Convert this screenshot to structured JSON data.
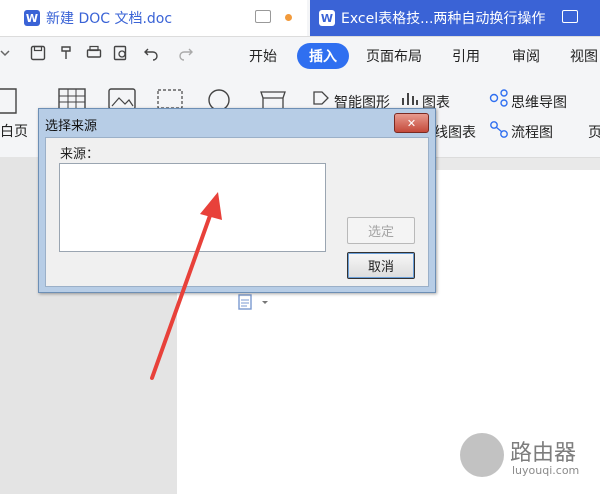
{
  "tabs": [
    {
      "title": "新建 DOC 文档.doc",
      "icon": "W"
    },
    {
      "title": "Excel表格技...两种自动换行操作",
      "icon": "W"
    }
  ],
  "ribbon_tabs": [
    "开始",
    "插入",
    "页面布局",
    "引用",
    "审阅",
    "视图"
  ],
  "ribbon_commands": {
    "smart_art": "智能图形",
    "chart": "图表",
    "mind_map": "思维导图",
    "online_chart": "线图表",
    "flowchart": "流程图",
    "page_partial": "白页",
    "right_partial": "页"
  },
  "dialog": {
    "title": "选择来源",
    "source_label": "来源：",
    "select_button": "选定",
    "cancel_button": "取消",
    "close_glyph": "✕"
  },
  "watermark": {
    "name": "路由器",
    "url": "luyouqi.com"
  },
  "colors": {
    "accent": "#2f6ff0",
    "arrow": "#e8413a"
  }
}
